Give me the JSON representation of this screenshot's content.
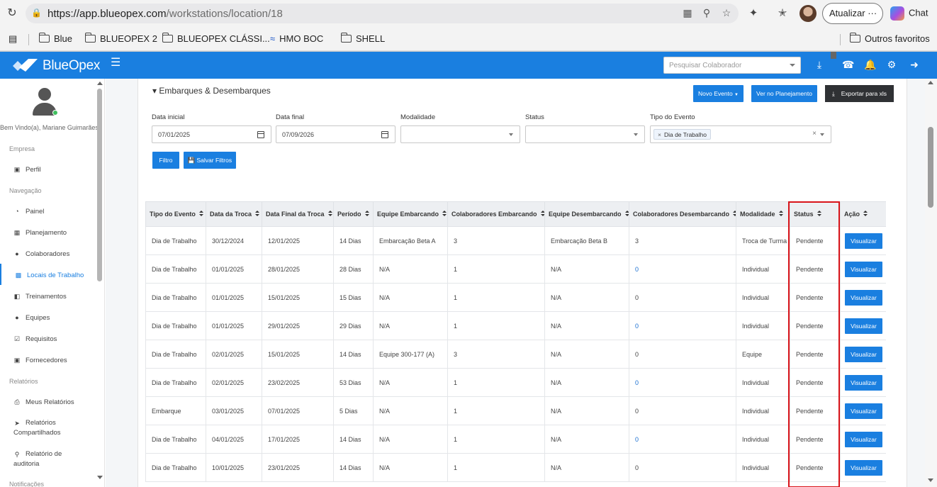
{
  "browser": {
    "url_host": "https://app.blueopex.com",
    "url_path": "/workstations/location/18",
    "update_label": "Atualizar",
    "copilot_label": "Chat",
    "bookmarks": [
      "Blue",
      "BLUEOPEX 2",
      "BLUEOPEX CLÁSSI...",
      "HMO BOC",
      "SHELL"
    ],
    "other_favorites": "Outros favoritos"
  },
  "header": {
    "brand": "BlueOpex",
    "search_placeholder": "Pesquisar Colaborador",
    "accent_color": "#1a7fe0"
  },
  "sidebar": {
    "welcome": "Bem Vindo(a), Mariane Guimarães",
    "sections": {
      "empresa": "Empresa",
      "navegacao": "Navegação",
      "relatorios": "Relatórios",
      "notificacoes": "Notificações"
    },
    "items": [
      {
        "label": "Perfil",
        "icon": "briefcase-icon"
      },
      {
        "label": "Painel",
        "icon": "dashboard-icon"
      },
      {
        "label": "Planejamento",
        "icon": "calendar-icon"
      },
      {
        "label": "Colaboradores",
        "icon": "users-icon"
      },
      {
        "label": "Locais de Trabalho",
        "icon": "building-icon"
      },
      {
        "label": "Treinamentos",
        "icon": "chalkboard-icon"
      },
      {
        "label": "Equipes",
        "icon": "team-icon"
      },
      {
        "label": "Requisitos",
        "icon": "checkbox-icon"
      },
      {
        "label": "Fornecedores",
        "icon": "briefcase-icon"
      },
      {
        "label": "Meus Relatórios",
        "icon": "print-icon"
      },
      {
        "label_line1": "Relatórios",
        "label_line2": "Compartilhados",
        "icon": "share-icon"
      },
      {
        "label_line1": "Relatório de",
        "label_line2": "auditoria",
        "icon": "search-icon"
      }
    ]
  },
  "main": {
    "section_title": "▾ Embarques & Desembarques",
    "buttons": {
      "novo_evento": "Novo Evento",
      "ver_planejamento": "Ver no Planejamento",
      "exportar": "Exportar para xls",
      "filtro": "Filtro",
      "salvar_filtros": "Salvar Filtros"
    },
    "filters": {
      "data_inicial_label": "Data inicial",
      "data_inicial_value": "07/01/2025",
      "data_final_label": "Data final",
      "data_final_value": "07/09/2026",
      "modalidade_label": "Modalidade",
      "status_label": "Status",
      "tipo_evento_label": "Tipo do Evento",
      "tipo_evento_tag": "Dia de Trabalho"
    },
    "table": {
      "columns": [
        "Tipo do Evento",
        "Data da Troca",
        "Data Final da Troca",
        "Período",
        "Equipe Embarcando",
        "Colaboradores Embarcando",
        "Equipe Desembarcando",
        "Colaboradores Desembarcando",
        "Modalidade",
        "Status",
        "Ação"
      ],
      "action_label": "Visualizar",
      "rows": [
        [
          "Dia de Trabalho",
          "30/12/2024",
          "12/01/2025",
          "14 Dias",
          "Embarcação Beta A",
          "3",
          "Embarcação Beta B",
          "3",
          "Troca de Turma",
          "Pendente"
        ],
        [
          "Dia de Trabalho",
          "01/01/2025",
          "28/01/2025",
          "28 Dias",
          "N/A",
          "1",
          "N/A",
          "0",
          "Individual",
          "Pendente"
        ],
        [
          "Dia de Trabalho",
          "01/01/2025",
          "15/01/2025",
          "15 Dias",
          "N/A",
          "1",
          "N/A",
          "0",
          "Individual",
          "Pendente"
        ],
        [
          "Dia de Trabalho",
          "01/01/2025",
          "29/01/2025",
          "29 Dias",
          "N/A",
          "1",
          "N/A",
          "0",
          "Individual",
          "Pendente"
        ],
        [
          "Dia de Trabalho",
          "02/01/2025",
          "15/01/2025",
          "14 Dias",
          "Equipe 300-177 (A)",
          "3",
          "N/A",
          "0",
          "Equipe",
          "Pendente"
        ],
        [
          "Dia de Trabalho",
          "02/01/2025",
          "23/02/2025",
          "53 Dias",
          "N/A",
          "1",
          "N/A",
          "0",
          "Individual",
          "Pendente"
        ],
        [
          "Embarque",
          "03/01/2025",
          "07/01/2025",
          "5 Dias",
          "N/A",
          "1",
          "N/A",
          "0",
          "Individual",
          "Pendente"
        ],
        [
          "Dia de Trabalho",
          "04/01/2025",
          "17/01/2025",
          "14 Dias",
          "N/A",
          "1",
          "N/A",
          "0",
          "Individual",
          "Pendente"
        ],
        [
          "Dia de Trabalho",
          "10/01/2025",
          "23/01/2025",
          "14 Dias",
          "N/A",
          "1",
          "N/A",
          "0",
          "Individual",
          "Pendente"
        ]
      ],
      "blue_desembarcando_rows": [
        1,
        3,
        5,
        7
      ]
    },
    "highlight_color": "#d8141a"
  }
}
